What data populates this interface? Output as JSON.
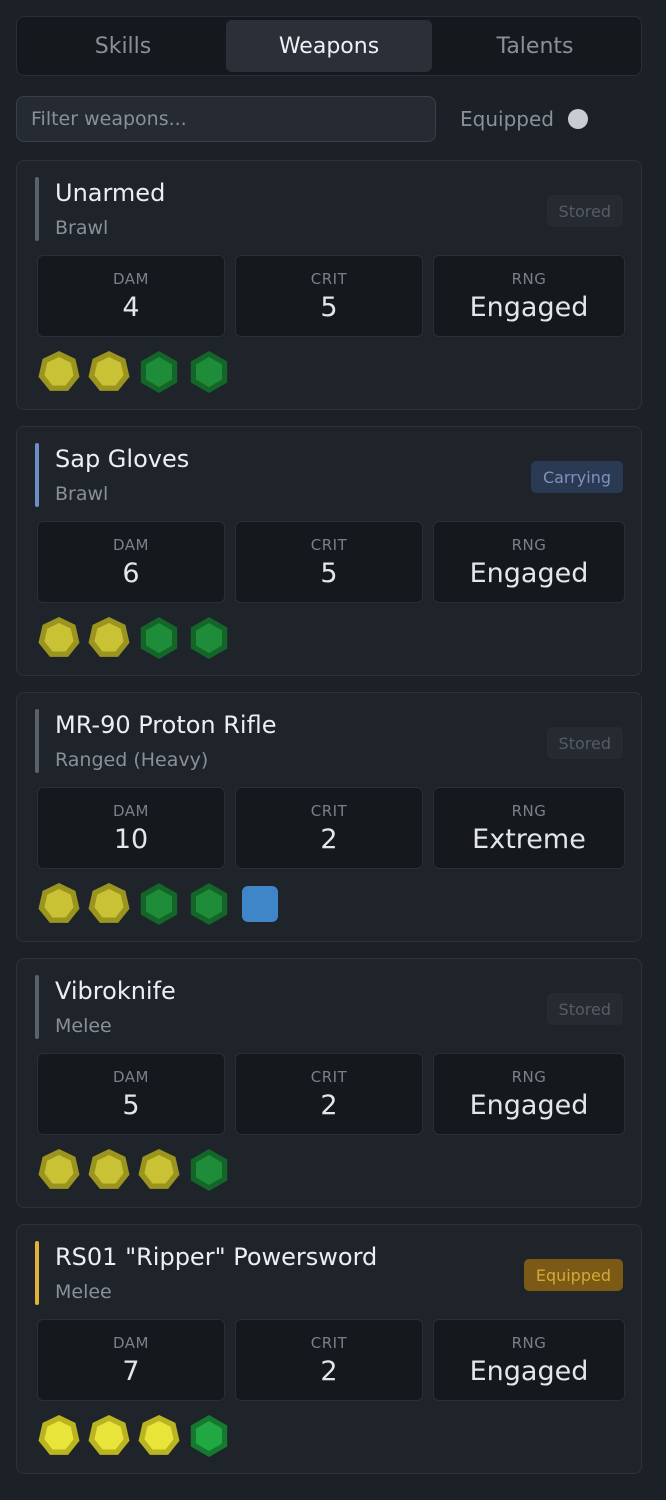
{
  "tabs": [
    {
      "label": "Skills",
      "active": false
    },
    {
      "label": "Weapons",
      "active": true
    },
    {
      "label": "Talents",
      "active": false
    }
  ],
  "filter": {
    "placeholder": "Filter weapons...",
    "value": "",
    "equipped_label": "Equipped",
    "equipped_on": false
  },
  "stat_labels": {
    "dam": "DAM",
    "crit": "CRIT",
    "rng": "RNG"
  },
  "colors": {
    "stored_accent": "#5c626c",
    "carrying_accent": "#6d8fc7",
    "equipped_accent": "#e0b23a",
    "ability_die": "#c9c234",
    "ability_die_bright": "#e8e43a",
    "proficiency_die": "#e8e43a",
    "ability_green": "#1f8c3a",
    "ability_green_bright": "#21a843",
    "challenge_blue": "#3f86c9"
  },
  "weapons": [
    {
      "name": "Unarmed",
      "type": "Brawl",
      "status": "Stored",
      "status_kind": "stored",
      "dam": "4",
      "crit": "5",
      "rng": "Engaged",
      "dice": [
        "ability-yellow",
        "ability-yellow",
        "ability-green",
        "ability-green"
      ]
    },
    {
      "name": "Sap Gloves",
      "type": "Brawl",
      "status": "Carrying",
      "status_kind": "carrying",
      "dam": "6",
      "crit": "5",
      "rng": "Engaged",
      "dice": [
        "ability-yellow",
        "ability-yellow",
        "ability-green",
        "ability-green"
      ]
    },
    {
      "name": "MR-90 Proton Rifle",
      "type": "Ranged (Heavy)",
      "status": "Stored",
      "status_kind": "stored",
      "dam": "10",
      "crit": "2",
      "rng": "Extreme",
      "dice": [
        "ability-yellow",
        "ability-yellow",
        "ability-green",
        "ability-green",
        "boost-blue"
      ]
    },
    {
      "name": "Vibroknife",
      "type": "Melee",
      "status": "Stored",
      "status_kind": "stored",
      "dam": "5",
      "crit": "2",
      "rng": "Engaged",
      "dice": [
        "ability-yellow",
        "ability-yellow",
        "ability-yellow",
        "ability-green"
      ]
    },
    {
      "name": "RS01 \"Ripper\" Powersword",
      "type": "Melee",
      "status": "Equipped",
      "status_kind": "equipped",
      "dam": "7",
      "crit": "2",
      "rng": "Engaged",
      "dice": [
        "proficiency-yellow",
        "proficiency-yellow",
        "proficiency-yellow",
        "ability-green-bright"
      ]
    }
  ]
}
